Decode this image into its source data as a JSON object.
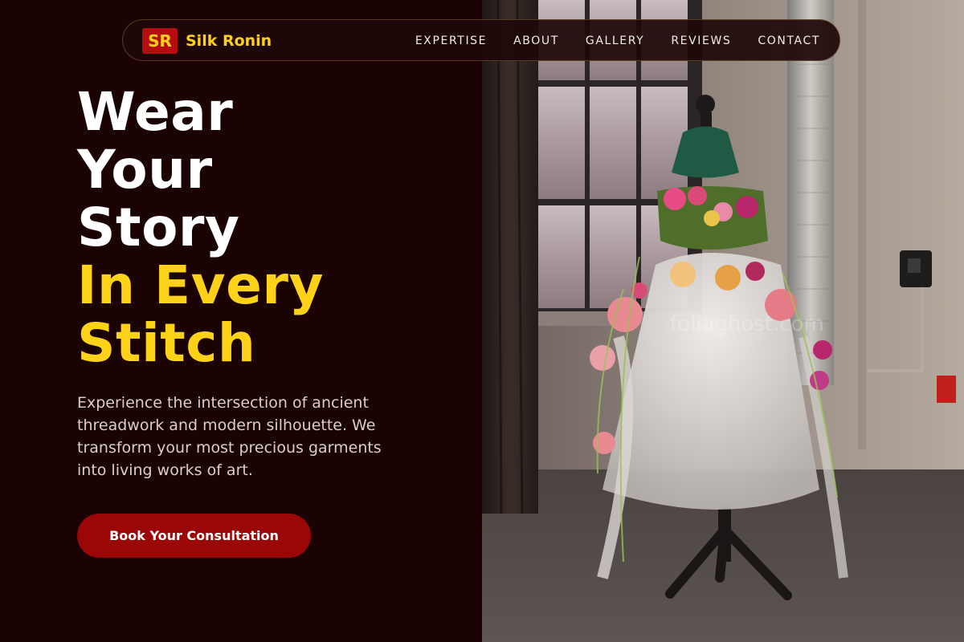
{
  "brand": {
    "badge": "SR",
    "name": "Silk Ronin"
  },
  "nav": {
    "items": [
      {
        "label": "EXPERTISE"
      },
      {
        "label": "ABOUT"
      },
      {
        "label": "GALLERY"
      },
      {
        "label": "REVIEWS"
      },
      {
        "label": "CONTACT"
      }
    ]
  },
  "hero": {
    "title_lines": [
      "Wear",
      "Your",
      "Story"
    ],
    "highlight_lines": [
      "In Every",
      "Stitch"
    ],
    "description": "Experience the intersection of ancient threadwork and modern silhouette. We transform your most precious garments into living works of art.",
    "cta_label": "Book Your Consultation"
  },
  "image": {
    "description": "floral-dress-mannequin-photo",
    "watermark": "foliaghost.com"
  },
  "colors": {
    "background": "#1b0203",
    "accent_gold": "#ffd21a",
    "accent_red": "#9b0707",
    "badge_red": "#b50d0d"
  }
}
